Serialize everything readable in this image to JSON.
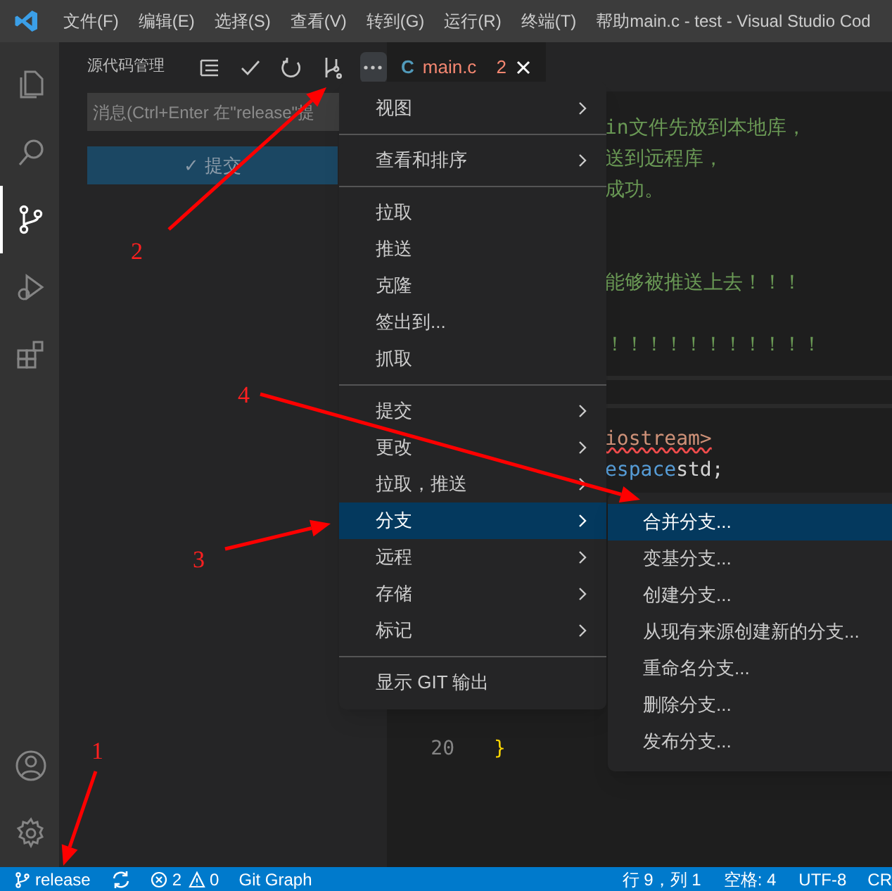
{
  "title_bar": {
    "menus": [
      "文件(F)",
      "编辑(E)",
      "选择(S)",
      "查看(V)",
      "转到(G)",
      "运行(R)",
      "终端(T)",
      "帮助"
    ],
    "title": "main.c - test - Visual Studio Cod"
  },
  "activity_bar": [
    {
      "selected": false
    },
    {
      "selected": false
    },
    {
      "selected": true
    },
    {
      "selected": false
    },
    {
      "selected": false
    },
    {
      "selected": false
    },
    {
      "selected": false
    }
  ],
  "sidebar": {
    "title": "源代码管理",
    "toolbar": [
      {
        "active": false
      },
      {
        "active": false
      },
      {
        "active": false
      },
      {
        "active": false
      },
      {
        "active": true
      }
    ],
    "message": {
      "placeholder": "消息(Ctrl+Enter 在\"release\"提"
    },
    "commit_button": {
      "label": "✓ 提交",
      "disabled": true
    }
  },
  "editor": {
    "tab": {
      "icon_text": "C",
      "label": "main.c",
      "problems": "2"
    },
    "lines": [
      {
        "kind": "fragment",
        "segments": [
          {
            "kind": "comment",
            "text": "in文件先放到本地库，"
          }
        ]
      },
      {
        "kind": "fragment",
        "segments": [
          {
            "kind": "comment",
            "text": "送到远程库，"
          }
        ]
      },
      {
        "kind": "fragment",
        "segments": [
          {
            "kind": "comment",
            "text": "成功。"
          }
        ]
      },
      {
        "kind": "blank"
      },
      {
        "kind": "blank"
      },
      {
        "kind": "fragment",
        "segments": [
          {
            "kind": "comment",
            "text": "能够被推送上去！！！"
          }
        ]
      },
      {
        "kind": "blank"
      },
      {
        "kind": "fragment",
        "segments": [
          {
            "kind": "comment",
            "text": "！！！！！！！！！！！"
          }
        ]
      },
      {
        "kind": "divider"
      },
      {
        "kind": "fragment",
        "segments": [
          {
            "kind": "include",
            "text": "iostream>"
          }
        ]
      },
      {
        "kind": "fragment",
        "segments": [
          {
            "kind": "keyword",
            "text": "espace"
          },
          {
            "kind": "plain",
            "text": " std;"
          }
        ]
      },
      {
        "kind": "blank"
      },
      {
        "kind": "blank"
      },
      {
        "kind": "blank"
      },
      {
        "kind": "blank"
      },
      {
        "kind": "blank"
      },
      {
        "kind": "blank"
      },
      {
        "kind": "blank"
      },
      {
        "kind": "blank"
      },
      {
        "kind": "code",
        "number": "20",
        "segments": [
          {
            "kind": "brace",
            "text": "}"
          }
        ]
      }
    ]
  },
  "context_menu": {
    "groups": [
      [
        {
          "label": "视图",
          "submenu": true,
          "selected": false
        }
      ],
      [
        {
          "label": "查看和排序",
          "submenu": true,
          "selected": false
        }
      ],
      [
        {
          "label": "拉取",
          "submenu": false,
          "selected": false
        },
        {
          "label": "推送",
          "submenu": false,
          "selected": false
        },
        {
          "label": "克隆",
          "submenu": false,
          "selected": false
        },
        {
          "label": "签出到...",
          "submenu": false,
          "selected": false
        },
        {
          "label": "抓取",
          "submenu": false,
          "selected": false
        }
      ],
      [
        {
          "label": "提交",
          "submenu": true,
          "selected": false
        },
        {
          "label": "更改",
          "submenu": true,
          "selected": false
        },
        {
          "label": "拉取，推送",
          "submenu": true,
          "selected": false
        },
        {
          "label": "分支",
          "submenu": true,
          "selected": true
        },
        {
          "label": "远程",
          "submenu": true,
          "selected": false
        },
        {
          "label": "存储",
          "submenu": true,
          "selected": false
        },
        {
          "label": "标记",
          "submenu": true,
          "selected": false
        }
      ],
      [
        {
          "label": "显示 GIT 输出",
          "submenu": false,
          "selected": false
        }
      ]
    ]
  },
  "submenu": [
    {
      "label": "合并分支...",
      "selected": true
    },
    {
      "label": "变基分支...",
      "selected": false
    },
    {
      "label": "创建分支...",
      "selected": false
    },
    {
      "label": "从现有来源创建新的分支...",
      "selected": false
    },
    {
      "label": "重命名分支...",
      "selected": false
    },
    {
      "label": "删除分支...",
      "selected": false
    },
    {
      "label": "发布分支...",
      "selected": false
    }
  ],
  "status_bar": {
    "left": [
      {
        "kind": "branch",
        "text": "release"
      },
      {
        "kind": "sync"
      },
      {
        "kind": "problems",
        "errors": "2",
        "warnings": "0"
      },
      {
        "kind": "text",
        "text": "Git Graph"
      }
    ],
    "right": [
      "行 9，列 1",
      "空格: 4",
      "UTF-8",
      "CR"
    ]
  },
  "annotations": [
    "1",
    "2",
    "3",
    "4"
  ]
}
